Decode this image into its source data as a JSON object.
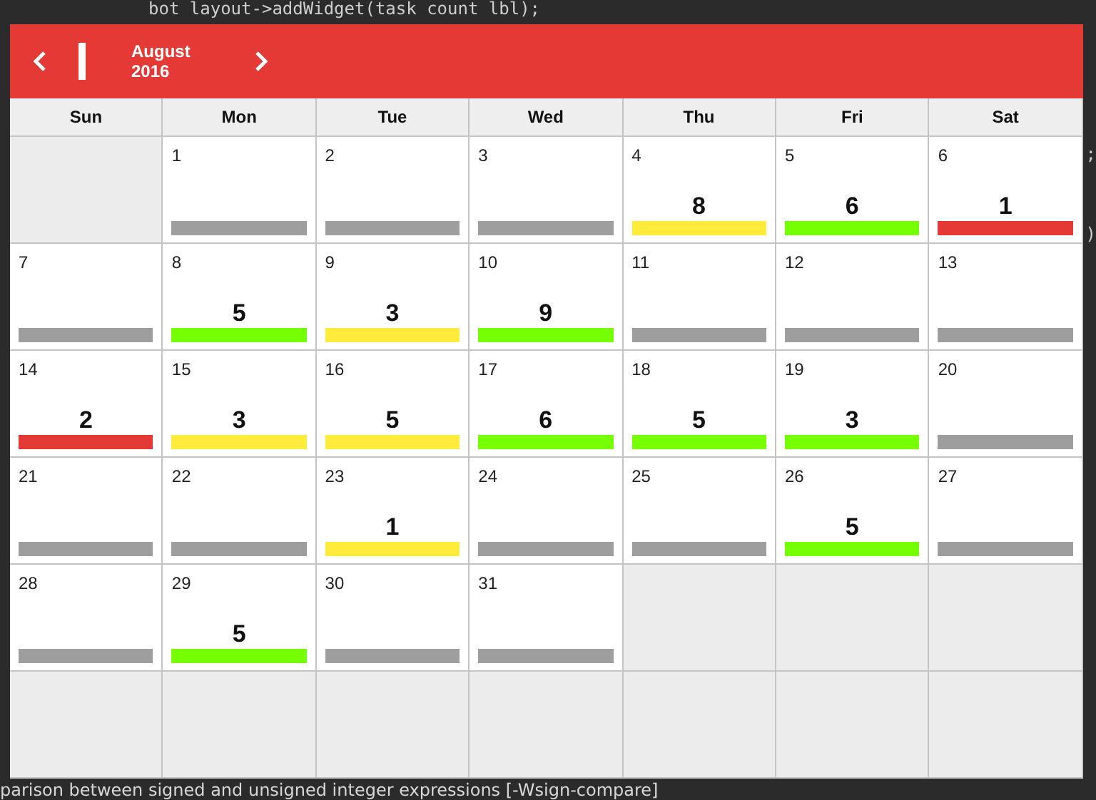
{
  "background_editor": {
    "code_line": "bot layout->addWidget(task count lbl);",
    "right_fragments": [
      ";",
      ")"
    ],
    "message": "parison between signed and unsigned integer expressions [-Wsign-compare]"
  },
  "calendar": {
    "month": "August",
    "year": "2016",
    "weekdays": [
      "Sun",
      "Mon",
      "Tue",
      "Wed",
      "Thu",
      "Fri",
      "Sat"
    ],
    "weeks": [
      [
        {
          "kind": "empty"
        },
        {
          "kind": "day",
          "day": "1",
          "color": "#9e9e9e"
        },
        {
          "kind": "day",
          "day": "2",
          "color": "#9e9e9e"
        },
        {
          "kind": "day",
          "day": "3",
          "color": "#9e9e9e"
        },
        {
          "kind": "day",
          "day": "4",
          "count": "8",
          "color": "#ffeb3b"
        },
        {
          "kind": "day",
          "day": "5",
          "count": "6",
          "color": "#76ff03"
        },
        {
          "kind": "day",
          "day": "6",
          "count": "1",
          "color": "#e53935"
        }
      ],
      [
        {
          "kind": "day",
          "day": "7",
          "color": "#9e9e9e"
        },
        {
          "kind": "day",
          "day": "8",
          "count": "5",
          "color": "#76ff03"
        },
        {
          "kind": "day",
          "day": "9",
          "count": "3",
          "color": "#ffeb3b"
        },
        {
          "kind": "day",
          "day": "10",
          "count": "9",
          "color": "#76ff03"
        },
        {
          "kind": "day",
          "day": "11",
          "color": "#9e9e9e"
        },
        {
          "kind": "day",
          "day": "12",
          "color": "#9e9e9e"
        },
        {
          "kind": "day",
          "day": "13",
          "color": "#9e9e9e"
        }
      ],
      [
        {
          "kind": "day",
          "day": "14",
          "count": "2",
          "color": "#e53935"
        },
        {
          "kind": "day",
          "day": "15",
          "count": "3",
          "color": "#ffeb3b"
        },
        {
          "kind": "day",
          "day": "16",
          "count": "5",
          "color": "#ffeb3b"
        },
        {
          "kind": "day",
          "day": "17",
          "count": "6",
          "color": "#76ff03"
        },
        {
          "kind": "day",
          "day": "18",
          "count": "5",
          "color": "#76ff03"
        },
        {
          "kind": "day",
          "day": "19",
          "count": "3",
          "color": "#76ff03"
        },
        {
          "kind": "day",
          "day": "20",
          "color": "#9e9e9e"
        }
      ],
      [
        {
          "kind": "day",
          "day": "21",
          "color": "#9e9e9e"
        },
        {
          "kind": "day",
          "day": "22",
          "color": "#9e9e9e"
        },
        {
          "kind": "day",
          "day": "23",
          "count": "1",
          "color": "#ffeb3b"
        },
        {
          "kind": "day",
          "day": "24",
          "color": "#9e9e9e"
        },
        {
          "kind": "day",
          "day": "25",
          "color": "#9e9e9e"
        },
        {
          "kind": "day",
          "day": "26",
          "count": "5",
          "color": "#76ff03"
        },
        {
          "kind": "day",
          "day": "27",
          "color": "#9e9e9e"
        }
      ],
      [
        {
          "kind": "day",
          "day": "28",
          "color": "#9e9e9e"
        },
        {
          "kind": "day",
          "day": "29",
          "count": "5",
          "color": "#76ff03"
        },
        {
          "kind": "day",
          "day": "30",
          "color": "#9e9e9e"
        },
        {
          "kind": "day",
          "day": "31",
          "color": "#9e9e9e"
        },
        {
          "kind": "empty"
        },
        {
          "kind": "empty"
        },
        {
          "kind": "empty"
        }
      ],
      [
        {
          "kind": "empty"
        },
        {
          "kind": "empty"
        },
        {
          "kind": "empty"
        },
        {
          "kind": "empty"
        },
        {
          "kind": "empty"
        },
        {
          "kind": "empty"
        },
        {
          "kind": "empty"
        }
      ]
    ]
  }
}
